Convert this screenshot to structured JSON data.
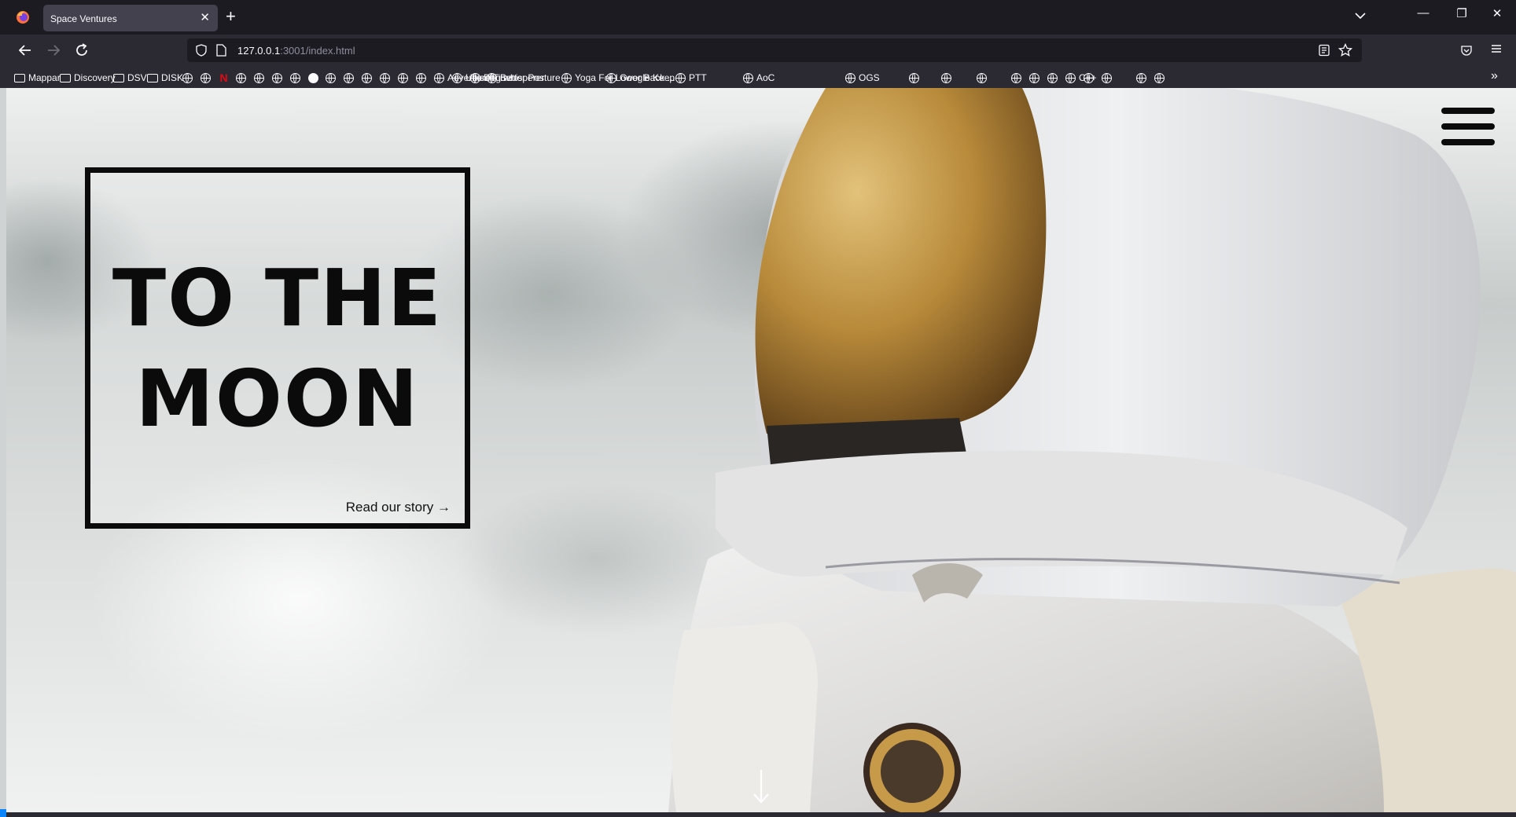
{
  "browser": {
    "tab_title": "Space Ventures",
    "tab_close": "✕",
    "new_tab": "+",
    "window_controls": {
      "minimize": "—",
      "restore": "❐",
      "close": "✕"
    },
    "url_host": "127.0.0.1",
    "url_path": ":3001/index.html",
    "icons": [
      "firefox-logo",
      "back-arrow",
      "forward-arrow",
      "reload",
      "shield",
      "page",
      "reader-view",
      "bookmark-star",
      "pocket",
      "menu"
    ]
  },
  "bookmarks": [
    {
      "label": "Mappar",
      "icon": "folder"
    },
    {
      "label": "Discovery",
      "icon": "folder"
    },
    {
      "label": "DSV",
      "icon": "folder"
    },
    {
      "label": "DISK",
      "icon": "folder"
    },
    {
      "label": "",
      "icon": "globe"
    },
    {
      "label": "",
      "icon": "globe"
    },
    {
      "label": "",
      "icon": "netflix"
    },
    {
      "label": "",
      "icon": "globe"
    },
    {
      "label": "",
      "icon": "globe"
    },
    {
      "label": "",
      "icon": "globe"
    },
    {
      "label": "",
      "icon": "globe"
    },
    {
      "label": "",
      "icon": "github"
    },
    {
      "label": "",
      "icon": "globe"
    },
    {
      "label": "",
      "icon": "globe"
    },
    {
      "label": "",
      "icon": "globe"
    },
    {
      "label": "",
      "icon": "globe"
    },
    {
      "label": "",
      "icon": "globe"
    },
    {
      "label": "",
      "icon": "globe"
    },
    {
      "label": "Adventure Time",
      "icon": "globe"
    },
    {
      "label": "Ubisoft",
      "icon": "globe"
    },
    {
      "label": "Dog whisperer",
      "icon": "globe"
    },
    {
      "label": "Better Posture",
      "icon": "globe"
    },
    {
      "label": "Yoga For Lower Back ...",
      "icon": "globe"
    },
    {
      "label": "Google Keep",
      "icon": "globe"
    },
    {
      "label": "PTT",
      "icon": "globe"
    },
    {
      "label": "AoC",
      "icon": "globe"
    },
    {
      "label": "OGS",
      "icon": "globe"
    },
    {
      "label": "",
      "icon": "globe"
    },
    {
      "label": "",
      "icon": "globe"
    },
    {
      "label": "",
      "icon": "globe"
    },
    {
      "label": "",
      "icon": "globe"
    },
    {
      "label": "",
      "icon": "globe"
    },
    {
      "label": "",
      "icon": "globe"
    },
    {
      "label": "C++",
      "icon": "globe"
    },
    {
      "label": "",
      "icon": "globe"
    },
    {
      "label": "",
      "icon": "globe"
    },
    {
      "label": "",
      "icon": "globe"
    },
    {
      "label": "",
      "icon": "globe"
    }
  ],
  "bookmarks_overflow": "»",
  "page": {
    "hero_line1": "TO THE",
    "hero_line2": "MOON",
    "hero_link": "Read our story →",
    "icons": [
      "hamburger-menu",
      "scroll-down-arrow"
    ],
    "colors": {
      "frame": "#0b0b0b",
      "suit": "#e6e6e6",
      "visor": "#b58a3c"
    }
  }
}
